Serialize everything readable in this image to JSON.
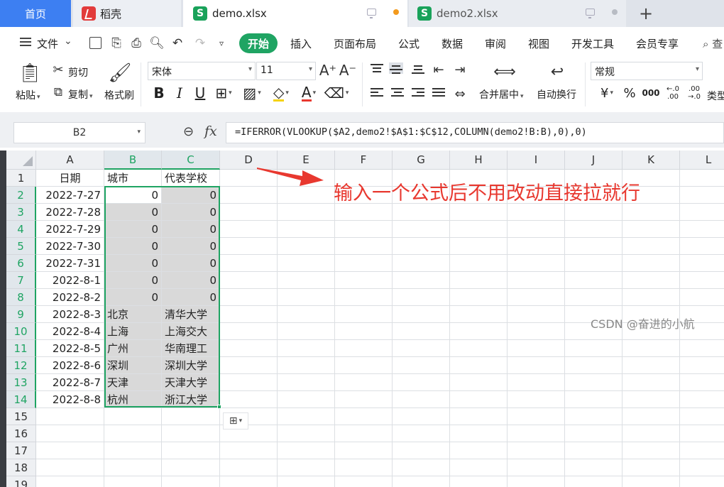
{
  "tabs": {
    "home": "首页",
    "daoke": "稻壳",
    "demo": "demo.xlsx",
    "demo2": "demo2.xlsx",
    "new_tab": "+",
    "spreadsheet_logo": "S"
  },
  "menu": {
    "file": "文件",
    "items": [
      "开始",
      "插入",
      "页面布局",
      "公式",
      "数据",
      "审阅",
      "视图",
      "开发工具",
      "会员专享"
    ],
    "search_stub": "查"
  },
  "ribbon": {
    "paste": "粘贴",
    "cut": "剪切",
    "copy": "复制",
    "format_painter": "格式刷",
    "font_name": "宋体",
    "font_size": "11",
    "merge_center": "合并居中",
    "wrap_text": "自动换行",
    "number_format": "常规",
    "type_stub": "类型",
    "currency": "¥",
    "percent": "%",
    "thousands": "000",
    "dec_up_top": "←.0",
    "dec_up_bottom": ".00",
    "dec_down_top": ".00",
    "dec_down_bottom": "→.0",
    "font_grow": "A⁺",
    "font_shrink": "A⁻",
    "bold": "B",
    "italic": "I",
    "underline": "U"
  },
  "formula_bar": {
    "name_box": "B2",
    "fx": "fx",
    "formula": "=IFERROR(VLOOKUP($A2,demo2!$A$1:$C$12,COLUMN(demo2!B:B),0),0)"
  },
  "sheet": {
    "columns": [
      "A",
      "B",
      "C",
      "D",
      "E",
      "F",
      "G",
      "H",
      "I",
      "J",
      "K",
      "L"
    ],
    "row_numbers": [
      "1",
      "2",
      "3",
      "4",
      "5",
      "6",
      "7",
      "8",
      "9",
      "10",
      "11",
      "12",
      "13",
      "14",
      "15",
      "16",
      "17",
      "18",
      "19"
    ],
    "header_row": [
      "日期",
      "城市",
      "代表学校"
    ],
    "rows": [
      [
        "2022-7-27",
        "0",
        "0"
      ],
      [
        "2022-7-28",
        "0",
        "0"
      ],
      [
        "2022-7-29",
        "0",
        "0"
      ],
      [
        "2022-7-30",
        "0",
        "0"
      ],
      [
        "2022-7-31",
        "0",
        "0"
      ],
      [
        "2022-8-1",
        "0",
        "0"
      ],
      [
        "2022-8-2",
        "0",
        "0"
      ],
      [
        "2022-8-3",
        "北京",
        "清华大学"
      ],
      [
        "2022-8-4",
        "上海",
        "上海交大"
      ],
      [
        "2022-8-5",
        "广州",
        "华南理工"
      ],
      [
        "2022-8-6",
        "深圳",
        "深圳大学"
      ],
      [
        "2022-8-7",
        "天津",
        "天津大学"
      ],
      [
        "2022-8-8",
        "杭州",
        "浙江大学"
      ]
    ],
    "selected_range": "B2:C14"
  },
  "annotation": {
    "text": "输入一个公式后不用改动直接拉就行",
    "color": "#e8382f"
  },
  "watermark": "CSDN @奋进的小航",
  "colors": {
    "accent_green": "#1fa463",
    "home_tab_blue": "#3d7ff2",
    "cell_shade": "#d9d9d9"
  }
}
